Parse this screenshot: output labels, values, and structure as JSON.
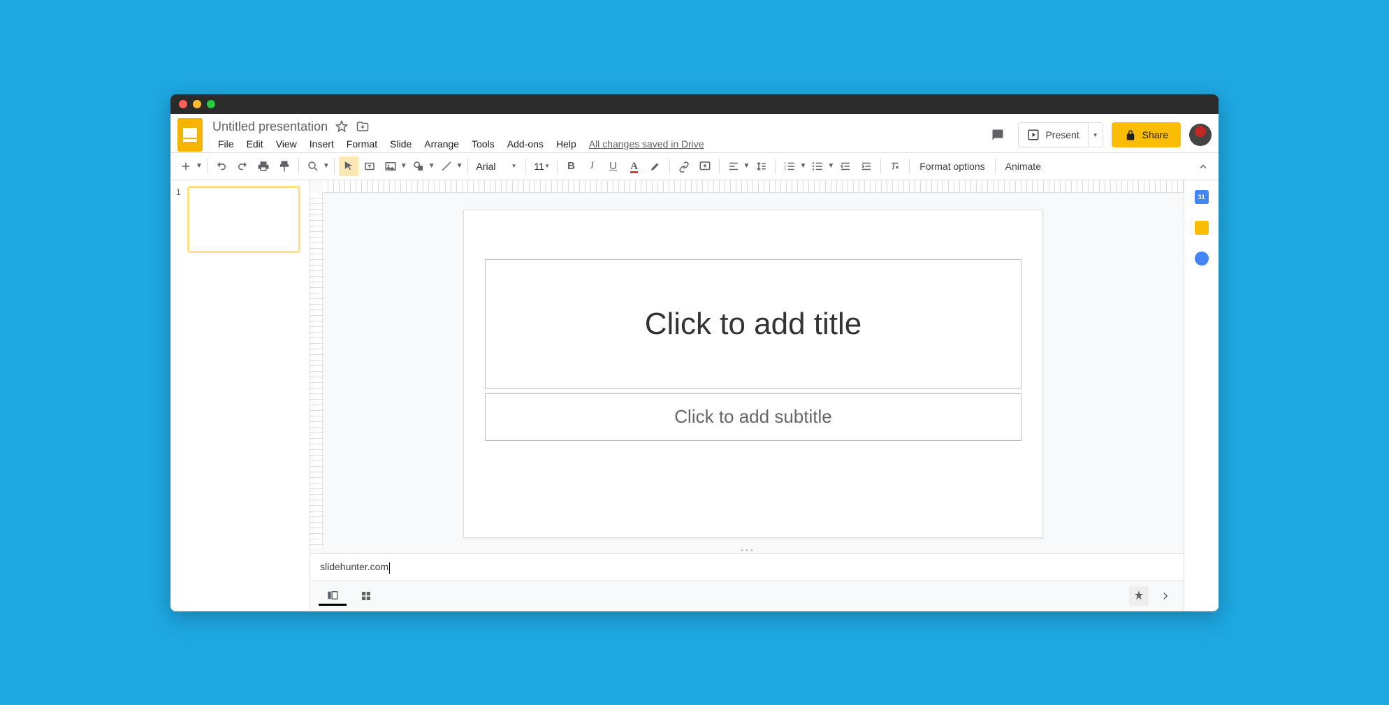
{
  "doc": {
    "title": "Untitled presentation",
    "saved_status": "All changes saved in Drive"
  },
  "menus": {
    "file": "File",
    "edit": "Edit",
    "view": "View",
    "insert": "Insert",
    "format": "Format",
    "slide": "Slide",
    "arrange": "Arrange",
    "tools": "Tools",
    "addons": "Add-ons",
    "help": "Help"
  },
  "header": {
    "present": "Present",
    "share": "Share"
  },
  "toolbar": {
    "font": "Arial",
    "size": "11",
    "format_options": "Format options",
    "animate": "Animate"
  },
  "thumbs": {
    "num1": "1"
  },
  "slide": {
    "title_ph": "Click to add title",
    "subtitle_ph": "Click to add subtitle"
  },
  "notes": {
    "text": "slidehunter.com"
  }
}
